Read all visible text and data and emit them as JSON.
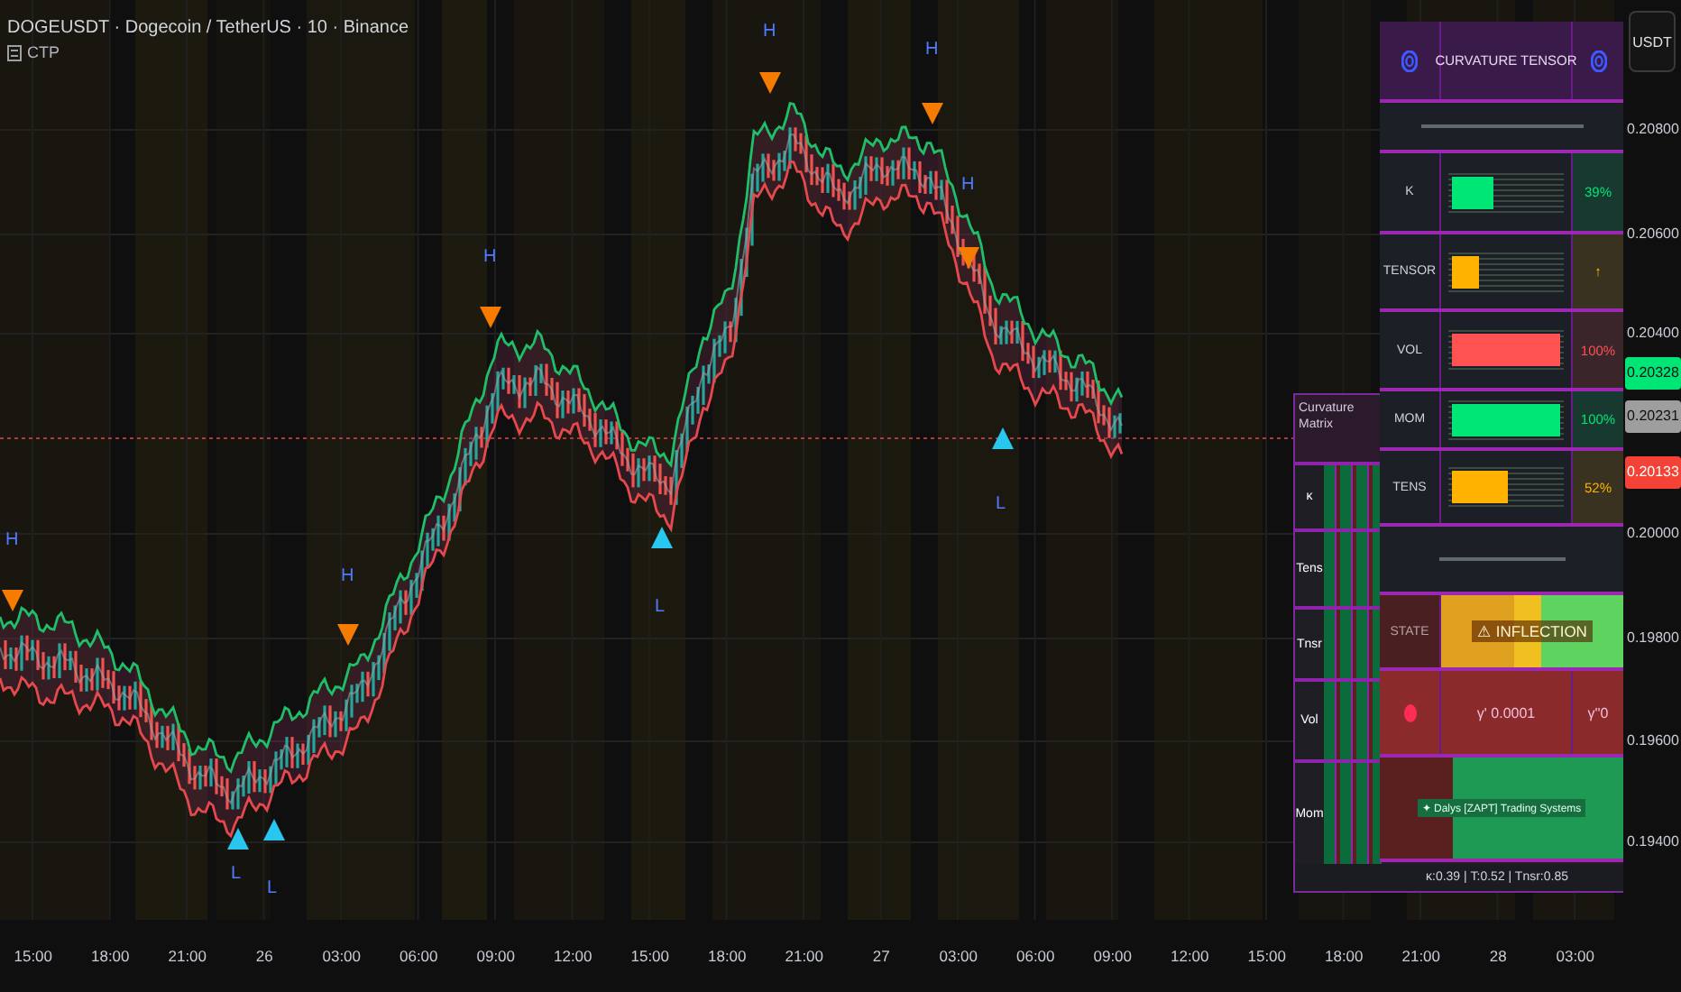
{
  "header": {
    "symbol": "DOGEUSDT · Dogecoin / TetherUS · 10 · Binance",
    "indicator": "CTP"
  },
  "markers": [
    {
      "kind": "high",
      "label": "H"
    },
    {
      "kind": "low",
      "label": "L"
    },
    {
      "kind": "low",
      "label": "L"
    },
    {
      "kind": "high",
      "label": "H"
    },
    {
      "kind": "high",
      "label": "H"
    },
    {
      "kind": "low",
      "label": "L"
    },
    {
      "kind": "high",
      "label": "H"
    },
    {
      "kind": "high",
      "label": "H"
    },
    {
      "kind": "high",
      "label": "H"
    },
    {
      "kind": "low",
      "label": "L"
    }
  ],
  "tensor_table": {
    "title": "CURVATURE TENSOR",
    "rows": [
      {
        "label": "K",
        "level": 0.39,
        "value": "39%",
        "color": "#00e676"
      },
      {
        "label": "TENSOR",
        "level": 0.25,
        "value": "↑",
        "color": "#ffb300"
      },
      {
        "label": "VOL",
        "level": 1,
        "value": "100%",
        "color": "#ff5252"
      },
      {
        "label": "MOM",
        "level": 1,
        "value": "100%",
        "color": "#00e676"
      },
      {
        "label": "TENS",
        "level": 0.52,
        "value": "52%",
        "color": "#ffb300"
      }
    ],
    "state": {
      "label": "STATE",
      "value": "⚠ INFLECTION"
    },
    "gamma": {
      "first": "γ' 0.0001",
      "second": "γ''0"
    },
    "credit": "✦ Dalys [ZAPT] Trading Systems",
    "footer": "κ:0.39 | T:0.52 | Tnsr:0.85"
  },
  "matrix": {
    "title": "Curvature Matrix",
    "rows": [
      {
        "label": "κ"
      },
      {
        "label": "Tens"
      },
      {
        "label": "Tnsr"
      },
      {
        "label": "Vol"
      },
      {
        "label": "Mom"
      }
    ]
  },
  "price_axis": {
    "unit_button": "USDT",
    "labels": [
      {
        "kind": "tick",
        "text": "0.20800"
      },
      {
        "kind": "tick",
        "text": "0.20600"
      },
      {
        "kind": "tick",
        "text": "0.20400"
      },
      {
        "kind": "badge",
        "text": "0.20328",
        "color": "#00e676"
      },
      {
        "kind": "badge",
        "text": "0.20231",
        "color": "#9e9e9e"
      },
      {
        "kind": "badge",
        "text": "0.20133",
        "color": "#f44336"
      },
      {
        "kind": "tick",
        "text": "0.20000"
      },
      {
        "kind": "tick",
        "text": "0.19800"
      },
      {
        "kind": "tick",
        "text": "0.19600"
      },
      {
        "kind": "tick",
        "text": "0.19400"
      }
    ]
  },
  "time_axis": [
    "15:00",
    "18:00",
    "21:00",
    "26",
    "03:00",
    "06:00",
    "09:00",
    "12:00",
    "15:00",
    "18:00",
    "21:00",
    "27",
    "03:00",
    "06:00",
    "09:00",
    "12:00",
    "15:00",
    "18:00",
    "21:00",
    "28",
    "03:00"
  ]
}
